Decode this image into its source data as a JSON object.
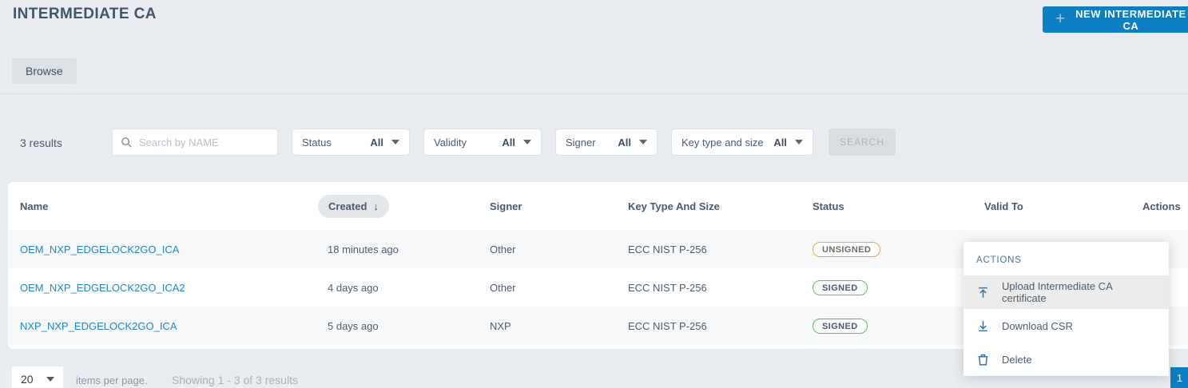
{
  "header": {
    "title": "INTERMEDIATE CA",
    "new_button_label": "NEW INTERMEDIATE CA"
  },
  "tabs": {
    "browse_label": "Browse"
  },
  "icons": {
    "plus": "+",
    "sort_desc": "↓",
    "caret_down": "▾"
  },
  "filters": {
    "results_count": "3 results",
    "search_placeholder": "Search by NAME",
    "dropdowns": [
      {
        "label": "Status",
        "value": "All"
      },
      {
        "label": "Validity",
        "value": "All"
      },
      {
        "label": "Signer",
        "value": "All"
      },
      {
        "label": "Key type and size",
        "value": "All"
      }
    ],
    "search_button_label": "SEARCH"
  },
  "table": {
    "columns": [
      "Name",
      "Created",
      "Signer",
      "Key Type And Size",
      "Status",
      "Valid To",
      "Actions"
    ],
    "sorted_by": "Created",
    "sort_direction": "descending",
    "rows": [
      {
        "name": "OEM_NXP_EDGELOCK2GO_ICA",
        "created": "18 minutes ago",
        "signer": "Other",
        "key_type": "ECC NIST P-256",
        "status": "UNSIGNED"
      },
      {
        "name": "OEM_NXP_EDGELOCK2GO_ICA2",
        "created": "4 days ago",
        "signer": "Other",
        "key_type": "ECC NIST P-256",
        "status": "SIGNED"
      },
      {
        "name": "NXP_NXP_EDGELOCK2GO_ICA",
        "created": "5 days ago",
        "signer": "NXP",
        "key_type": "ECC NIST P-256",
        "status": "SIGNED"
      }
    ]
  },
  "actions_menu": {
    "title": "ACTIONS",
    "items": [
      {
        "label": "Upload Intermediate CA certificate"
      },
      {
        "label": "Download CSR"
      },
      {
        "label": "Delete"
      }
    ]
  },
  "pagination": {
    "page_size": "20",
    "items_per_page_label": "items per page.",
    "showing_text": "Showing 1 - 3 of 3 results",
    "current_page": "1"
  },
  "colors": {
    "primary_blue": "#0e7ec2",
    "link_blue": "#1d87c8",
    "page_background": "#e9edf1",
    "unsigned_badge_border": "#efa53d",
    "signed_badge_border": "#4fc455"
  }
}
